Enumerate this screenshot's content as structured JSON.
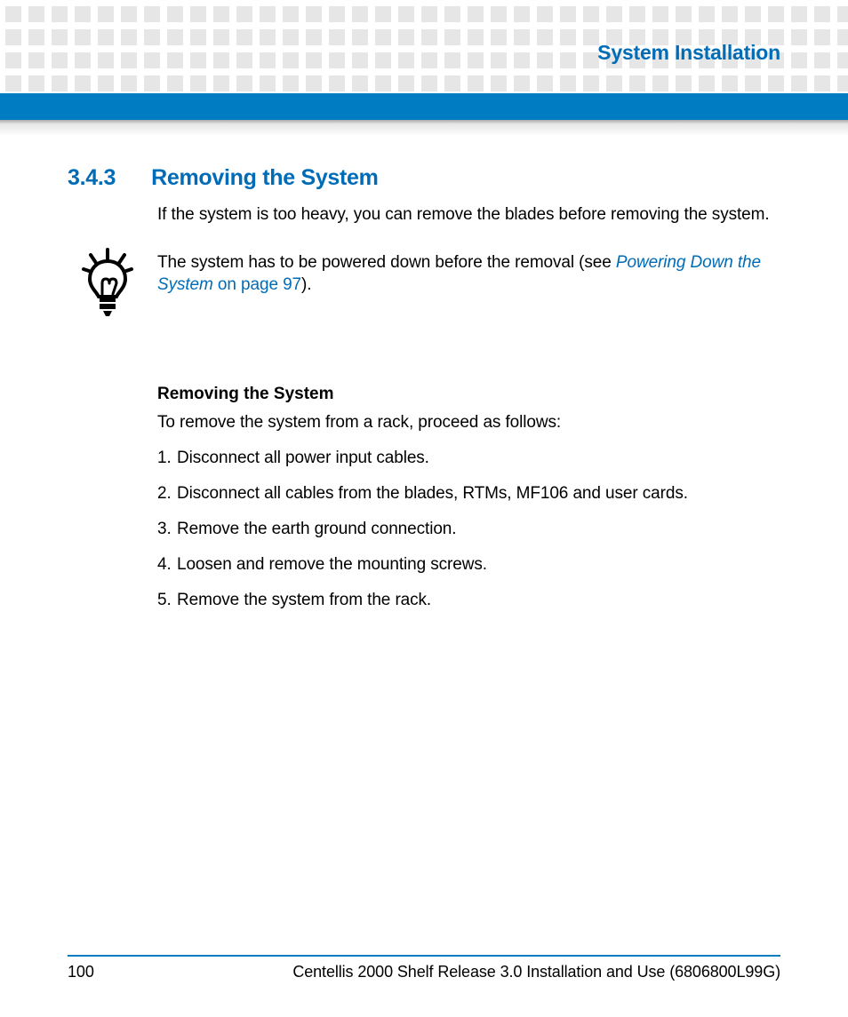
{
  "header": {
    "title": "System Installation"
  },
  "section": {
    "number": "3.4.3",
    "title": "Removing the System",
    "intro": "If the system is too heavy, you can remove the blades before removing the system."
  },
  "tip": {
    "prefix": "The system has to be powered down before the removal (see ",
    "link": "Powering Down the System",
    "link_trail": " on page 97",
    "suffix": ")."
  },
  "procedure": {
    "heading": "Removing the System",
    "lead": "To remove the system from a rack, proceed as follows:",
    "steps": [
      "Disconnect all power input cables.",
      "Disconnect all cables from the blades, RTMs, MF106 and user cards.",
      "Remove the earth ground connection.",
      "Loosen and remove the mounting screws.",
      "Remove the system from the rack."
    ]
  },
  "footer": {
    "page": "100",
    "doc": "Centellis 2000 Shelf Release 3.0 Installation and Use (6806800L99G)"
  }
}
